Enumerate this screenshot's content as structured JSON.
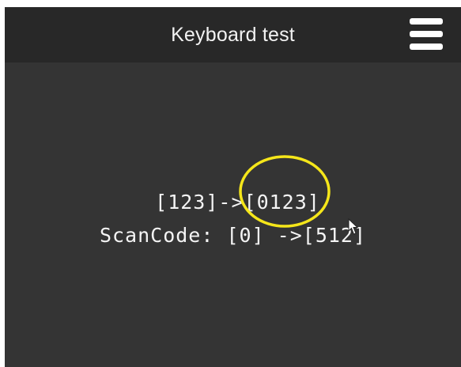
{
  "header": {
    "title": "Keyboard test"
  },
  "readout": {
    "key_mapping": "[123]->[0123]",
    "scan_code": "ScanCode: [0] ->[512]"
  },
  "icons": {
    "menu": "hamburger-menu-icon",
    "cursor": "mouse-pointer-icon"
  },
  "colors": {
    "header_background": "#282828",
    "app_background": "#343434",
    "text": "#f4f4f4",
    "annotation": "#f5e61a"
  }
}
